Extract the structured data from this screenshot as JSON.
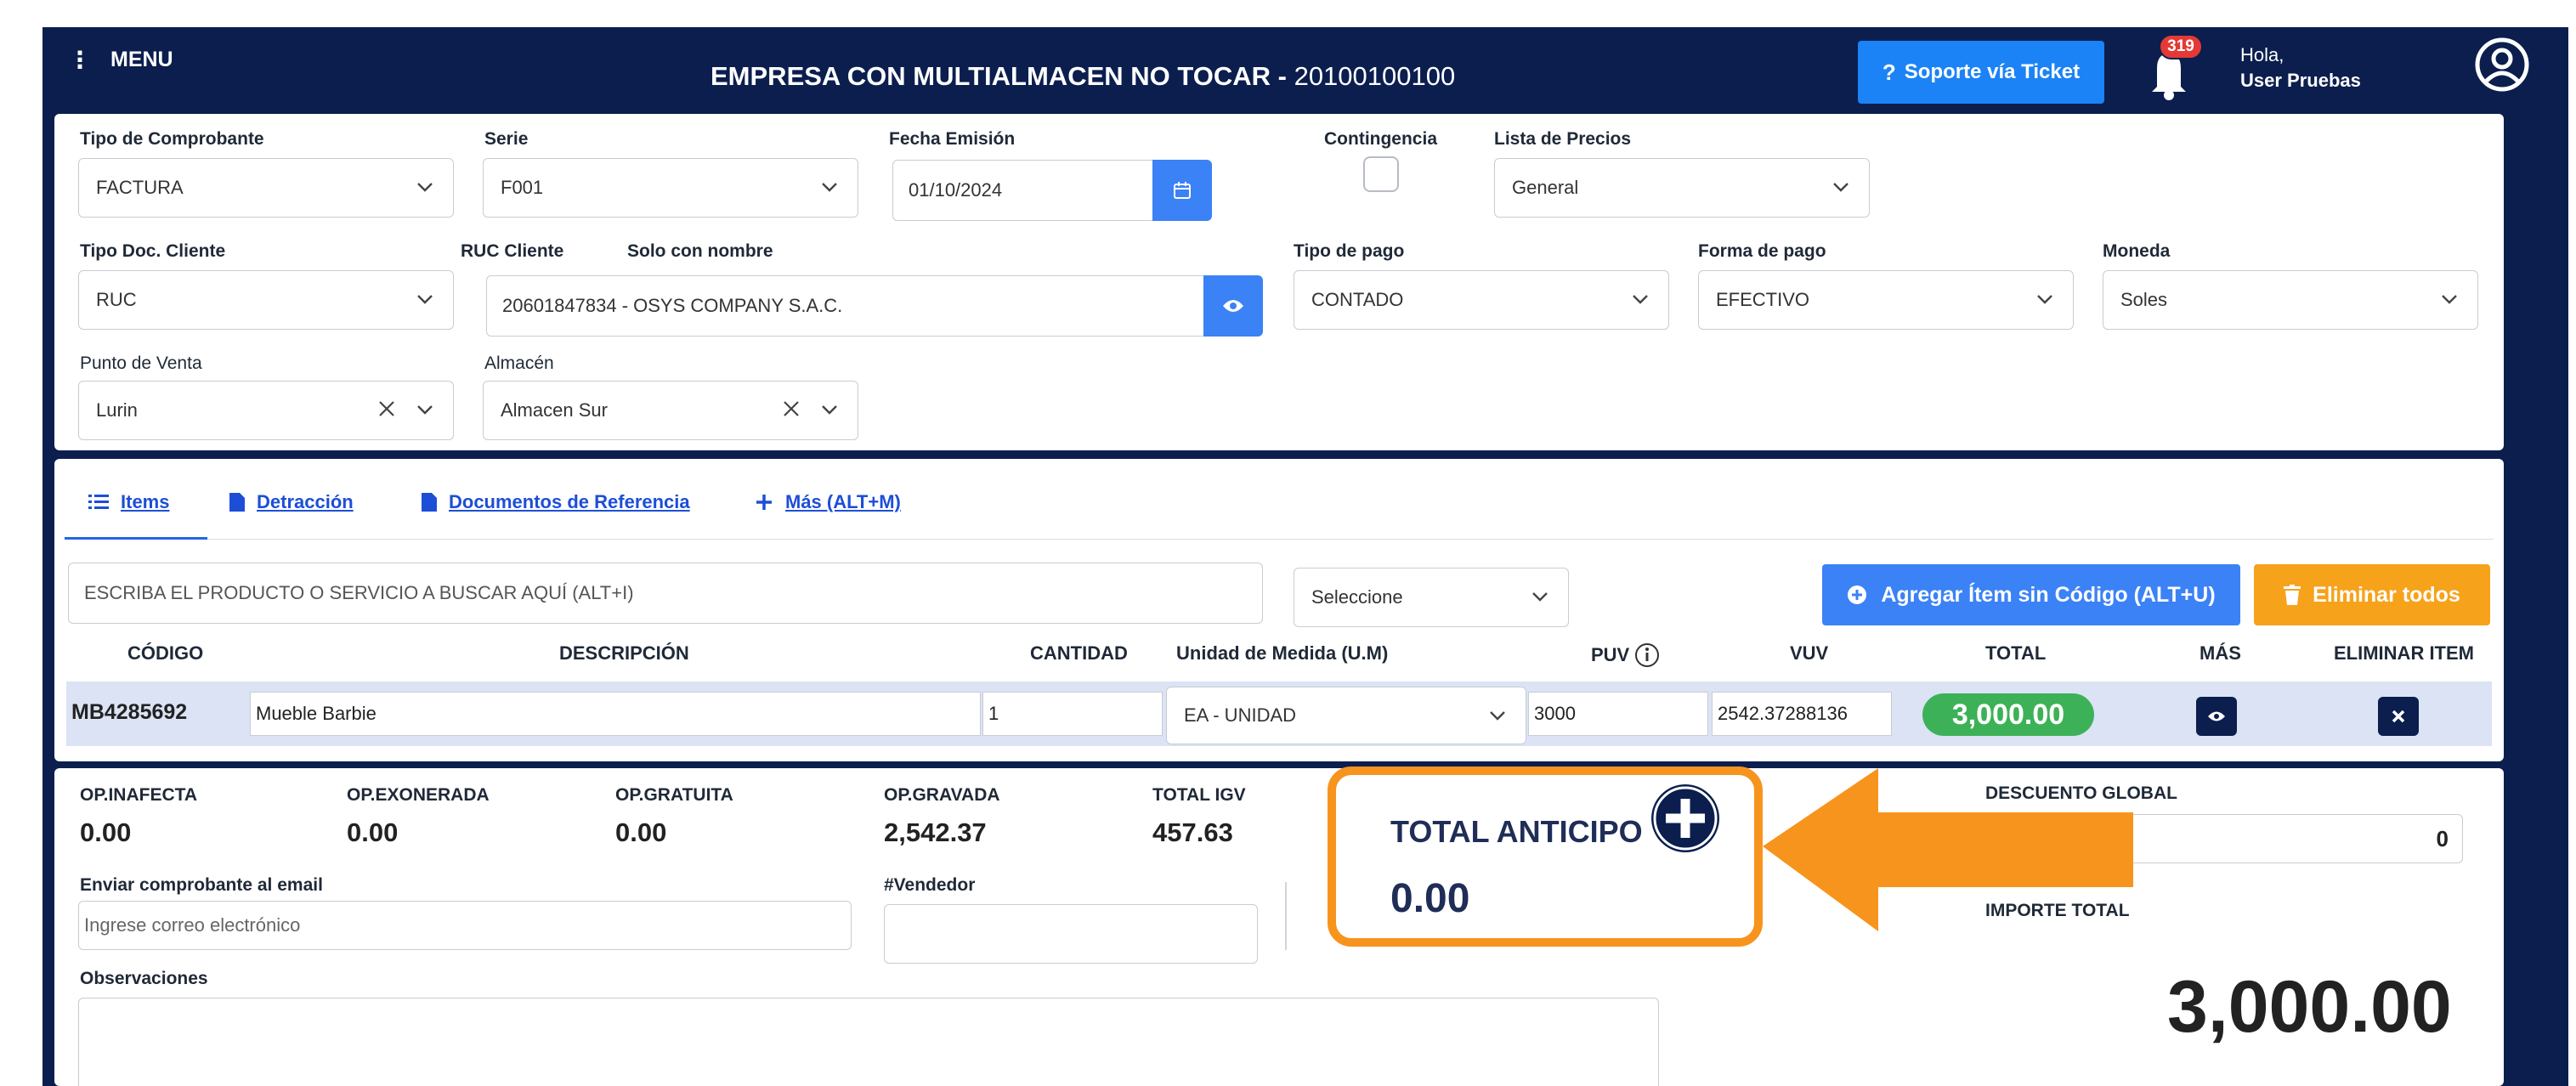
{
  "header": {
    "menu_label": "MENU",
    "company": "EMPRESA CON MULTIALMACEN NO TOCAR - ",
    "company_ruc": "20100100100",
    "support_label": "Soporte vía Ticket",
    "notifications_count": "319",
    "greeting": "Hola,",
    "user_name": "User Pruebas"
  },
  "form": {
    "tipo_comprobante": {
      "label": "Tipo de Comprobante",
      "value": "FACTURA"
    },
    "serie": {
      "label": "Serie",
      "value": "F001"
    },
    "fecha_emision": {
      "label": "Fecha Emisión",
      "value": "01/10/2024"
    },
    "contingencia": {
      "label": "Contingencia"
    },
    "lista_precios": {
      "label": "Lista de Precios",
      "value": "General"
    },
    "tipo_doc_cliente": {
      "label": "Tipo Doc. Cliente",
      "value": "RUC"
    },
    "ruc_cliente": {
      "label": "RUC Cliente",
      "alt_label": "Solo con nombre",
      "value": "20601847834 - OSYS COMPANY S.A.C."
    },
    "tipo_pago": {
      "label": "Tipo de pago",
      "value": "CONTADO"
    },
    "forma_pago": {
      "label": "Forma de pago",
      "value": "EFECTIVO"
    },
    "moneda": {
      "label": "Moneda",
      "value": "Soles"
    },
    "punto_venta": {
      "label": "Punto de Venta",
      "value": "Lurin"
    },
    "almacen": {
      "label": "Almacén",
      "value": "Almacen Sur"
    }
  },
  "tabs": [
    {
      "label": "Items"
    },
    {
      "label": "Detracción"
    },
    {
      "label": "Documentos de Referencia"
    },
    {
      "label": "Más (ALT+M)"
    }
  ],
  "items": {
    "search_placeholder": "ESCRIBA EL PRODUCTO O SERVICIO A BUSCAR AQUÍ (ALT+I)",
    "select_placeholder": "Seleccione",
    "add_button": "Agregar Ítem sin Código (ALT+U)",
    "delete_all_button": "Eliminar todos",
    "columns": [
      "CÓDIGO",
      "DESCRIPCIÓN",
      "CANTIDAD",
      "Unidad de Medida (U.M)",
      "PUV",
      "VUV",
      "TOTAL",
      "MÁS",
      "ELIMINAR ITEM"
    ],
    "rows": [
      {
        "codigo": "MB4285692",
        "descripcion": "Mueble Barbie",
        "cantidad": "1",
        "um": "EA - UNIDAD",
        "puv": "3000",
        "vuv": "2542.37288136",
        "total": "3,000.00"
      }
    ]
  },
  "summary": {
    "op_inafecta": {
      "label": "OP.INAFECTA",
      "value": "0.00"
    },
    "op_exonerada": {
      "label": "OP.EXONERADA",
      "value": "0.00"
    },
    "op_gratuita": {
      "label": "OP.GRATUITA",
      "value": "0.00"
    },
    "op_gravada": {
      "label": "OP.GRAVADA",
      "value": "2,542.37"
    },
    "total_igv": {
      "label": "TOTAL IGV",
      "value": "457.63"
    },
    "total_anticipo": {
      "label": "TOTAL ANTICIPO",
      "value": "0.00"
    },
    "descuento_global": {
      "label": "DESCUENTO GLOBAL",
      "value": "0"
    },
    "importe_total": {
      "label": "IMPORTE TOTAL",
      "value": "3,000.00"
    },
    "email": {
      "label": "Enviar comprobante al email",
      "placeholder": "Ingrese correo electrónico"
    },
    "vendedor": {
      "label": "#Vendedor"
    },
    "observaciones": {
      "label": "Observaciones"
    }
  },
  "colors": {
    "navy": "#0b1e4e",
    "blue": "#3b82f6",
    "orange": "#f7941d",
    "green": "#3db157"
  }
}
